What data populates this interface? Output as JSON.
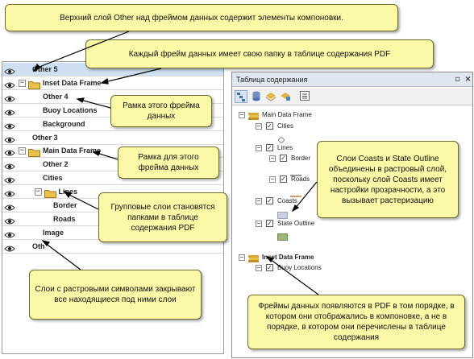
{
  "pdf_layers": [
    {
      "label": "Other 5",
      "indent": 1,
      "selected": true,
      "expander": "",
      "folder": false
    },
    {
      "label": "Inset Data Frame",
      "indent": 0,
      "selected": false,
      "expander": "−",
      "folder": true
    },
    {
      "label": "Other 4",
      "indent": 2,
      "selected": false,
      "expander": "",
      "folder": false
    },
    {
      "label": "Buoy Locations",
      "indent": 2,
      "selected": false,
      "expander": "",
      "folder": false
    },
    {
      "label": "Background",
      "indent": 2,
      "selected": false,
      "expander": "",
      "folder": false
    },
    {
      "label": "Other 3",
      "indent": 1,
      "selected": false,
      "expander": "",
      "folder": false
    },
    {
      "label": "Main Data Frame",
      "indent": 0,
      "selected": false,
      "expander": "−",
      "folder": true
    },
    {
      "label": "Other 2",
      "indent": 2,
      "selected": false,
      "expander": "",
      "folder": false
    },
    {
      "label": "Cities",
      "indent": 2,
      "selected": false,
      "expander": "",
      "folder": false
    },
    {
      "label": "Lines",
      "indent": 1.5,
      "selected": false,
      "expander": "−",
      "folder": true
    },
    {
      "label": "Border",
      "indent": 3,
      "selected": false,
      "expander": "",
      "folder": false
    },
    {
      "label": "Roads",
      "indent": 3,
      "selected": false,
      "expander": "",
      "folder": false
    },
    {
      "label": "Image",
      "indent": 2,
      "selected": false,
      "expander": "",
      "folder": false
    },
    {
      "label": "Oth",
      "indent": 1,
      "selected": false,
      "expander": "",
      "folder": false
    }
  ],
  "toc": {
    "title": "Таблица содержания",
    "pin": "▫",
    "close": "×",
    "items": {
      "main_df": "Main Data Frame",
      "cities": "Cities",
      "lines": "Lines",
      "border": "Border",
      "roads": "Roads",
      "coasts": "Coasts",
      "state": "State Outline",
      "inset_df": "Inset Data Frame",
      "buoy": "Buoy Locations",
      "check": "✓",
      "minus": "−"
    }
  },
  "callouts": {
    "top_layer": "Верхний слой Other  над фреймом данных содержит элементы компоновки.",
    "folder": "Каждый фрейм данных имеет свою папку в таблице содержания PDF",
    "frame1": "Рамка этого фрейма данных",
    "frame2": "Рамка для этого фрейма данных",
    "groups": "Групповые слои становятся папками в таблице содержания PDF",
    "raster_symbols": "Слои с растровыми символами закрывают все находящиеся под ними слои",
    "coasts": "Слои Coasts и State Outline объединены в растровый слой, поскольку слой Coasts имеет настройки прозрачности, а это вызывает растеризацию",
    "order": "Фреймы данных появляются в PDF в том порядке, в котором они отображались в компоновке, а не в порядке, в котором они перечислены в таблице содержания"
  },
  "colors": {
    "callout": "#fbf8a8",
    "selected_row": "#cfe0f3",
    "folder": "#e8c24a"
  }
}
